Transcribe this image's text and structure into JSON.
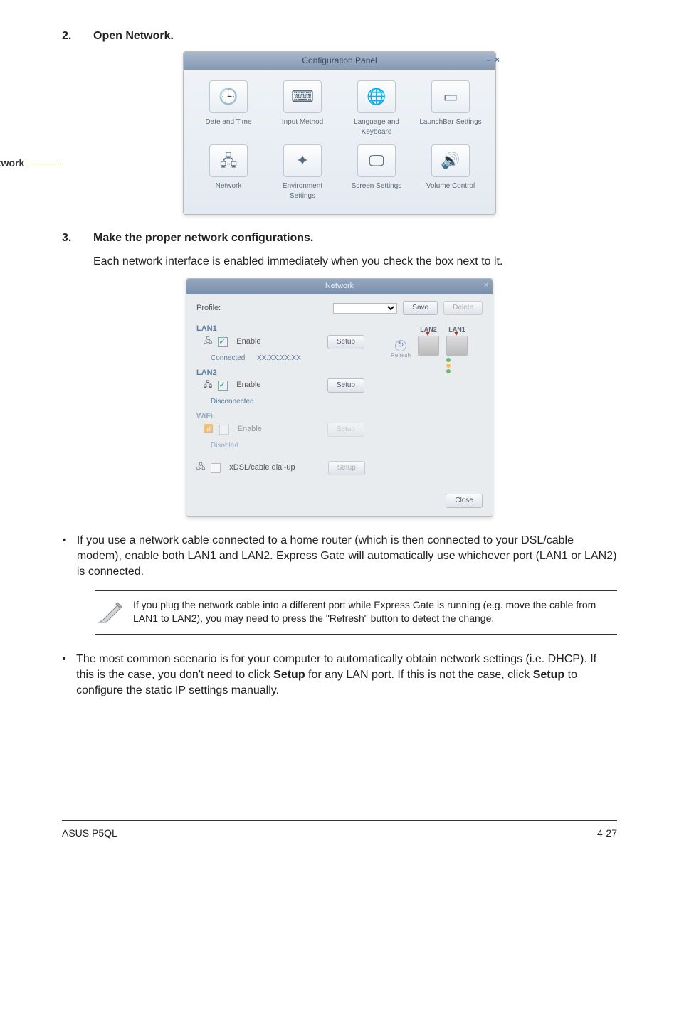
{
  "steps": {
    "s2": {
      "num": "2.",
      "text": "Open Network."
    },
    "s3": {
      "num": "3.",
      "text": "Make the proper network configurations."
    },
    "s3body": "Each network interface is enabled immediately when you check the box next to it."
  },
  "network_label": "Network",
  "configpanel": {
    "title": "Configuration Panel",
    "items": {
      "date": "Date and Time",
      "input": "Input Method",
      "lang": "Language and Keyboard",
      "launch": "LaunchBar Settings",
      "network": "Network",
      "env": "Environment Settings",
      "screen": "Screen Settings",
      "volume": "Volume Control"
    }
  },
  "netdlg": {
    "title": "Network",
    "profile_label": "Profile:",
    "save_btn": "Save",
    "delete_btn": "Delete",
    "lan1": {
      "label": "LAN1",
      "enable": "Enable",
      "setup": "Setup",
      "status": "Connected",
      "ip": "XX.XX.XX.XX"
    },
    "lan2": {
      "label": "LAN2",
      "enable": "Enable",
      "setup": "Setup",
      "status": "Disconnected"
    },
    "wifi": {
      "label": "WiFi",
      "enable": "Enable",
      "setup": "Setup",
      "status": "Disabled"
    },
    "ports": {
      "lan2": "LAN2",
      "lan1": "LAN1"
    },
    "dialup": {
      "enable": "xDSL/cable dial-up",
      "setup": "Setup"
    },
    "close_btn": "Close"
  },
  "bullet1": "If you use a network cable connected to a home router (which is then connected to your DSL/cable modem), enable both LAN1 and LAN2. Express Gate will automatically use whichever port (LAN1 or LAN2) is connected.",
  "note": "If you plug the network cable into a different port while Express Gate  is running (e.g. move the cable from LAN1 to LAN2), you may need to press the \"Refresh\" button to detect the change.",
  "bullet2": {
    "pre": "The most common scenario is for your computer to automatically obtain network settings (i.e. DHCP). If this is the case, you don't need to click ",
    "b1": "Setup",
    "mid": " for any LAN port. If this is not the case, click ",
    "b2": "Setup",
    "post": " to configure the static IP settings manually."
  },
  "footer": {
    "left": "ASUS P5QL",
    "right": "4-27"
  }
}
